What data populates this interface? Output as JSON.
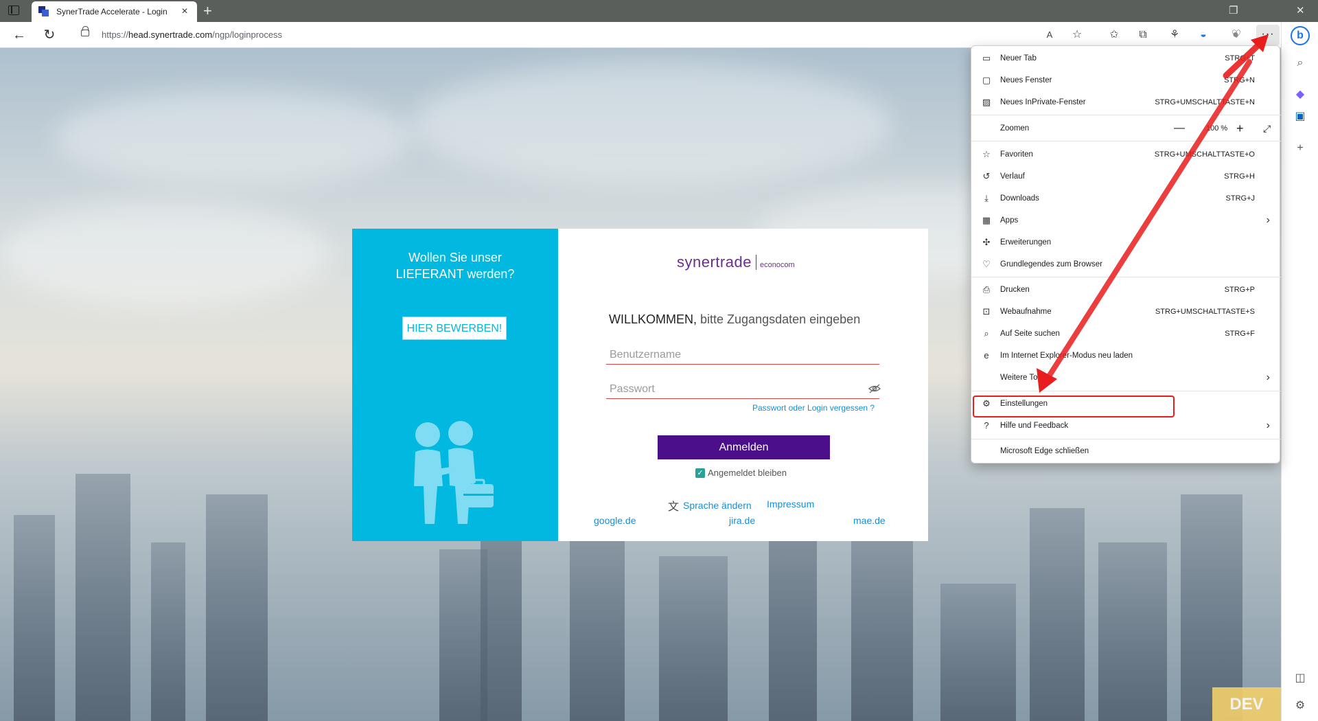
{
  "browser": {
    "tab_title": "SynerTrade Accelerate - Login",
    "url_prefix": "https://",
    "url_host": "head.synertrade.com",
    "url_path": "/ngp/loginprocess"
  },
  "supplier": {
    "title_line1": "Wollen Sie unser",
    "title_line2": "LIEFERANT werden?",
    "apply_label": "HIER BEWERBEN!"
  },
  "login": {
    "logo_main": "synertrade",
    "logo_sub": "econocom",
    "welcome_strong": "WILLKOMMEN,",
    "welcome_rest": " bitte Zugangsdaten eingeben",
    "username_placeholder": "Benutzername",
    "password_placeholder": "Passwort",
    "forgot_label": "Passwort oder Login vergessen ?",
    "submit_label": "Anmelden",
    "remember_label": "Angemeldet bleiben",
    "language_label": "Sprache ändern",
    "impressum_label": "Impressum",
    "links": [
      "google.de",
      "jira.de",
      "mae.de"
    ]
  },
  "environment_badge": "DEV",
  "menu": {
    "items": [
      {
        "label": "Neuer Tab",
        "shortcut": "STRG+T"
      },
      {
        "label": "Neues Fenster",
        "shortcut": "STRG+N"
      },
      {
        "label": "Neues InPrivate-Fenster",
        "shortcut": "STRG+UMSCHALTTASTE+N"
      },
      {
        "label": "Zoomen",
        "value": "100 %"
      },
      {
        "label": "Favoriten",
        "shortcut": "STRG+UMSCHALTTASTE+O"
      },
      {
        "label": "Verlauf",
        "shortcut": "STRG+H"
      },
      {
        "label": "Downloads",
        "shortcut": "STRG+J"
      },
      {
        "label": "Apps"
      },
      {
        "label": "Erweiterungen"
      },
      {
        "label": "Grundlegendes zum Browser"
      },
      {
        "label": "Drucken",
        "shortcut": "STRG+P"
      },
      {
        "label": "Webaufnahme",
        "shortcut": "STRG+UMSCHALTTASTE+S"
      },
      {
        "label": "Auf Seite suchen",
        "shortcut": "STRG+F"
      },
      {
        "label": "Im Internet Explorer-Modus neu laden"
      },
      {
        "label": "Weitere Tools"
      },
      {
        "label": "Einstellungen"
      },
      {
        "label": "Hilfe und Feedback"
      },
      {
        "label": "Microsoft Edge schließen"
      }
    ]
  },
  "colors": {
    "supplier_panel": "#00b8e0",
    "login_button": "#4b0f8c",
    "link": "#1a8dd0",
    "annotation_red": "#e81e1e",
    "dev_badge": "#f2cf6a"
  }
}
